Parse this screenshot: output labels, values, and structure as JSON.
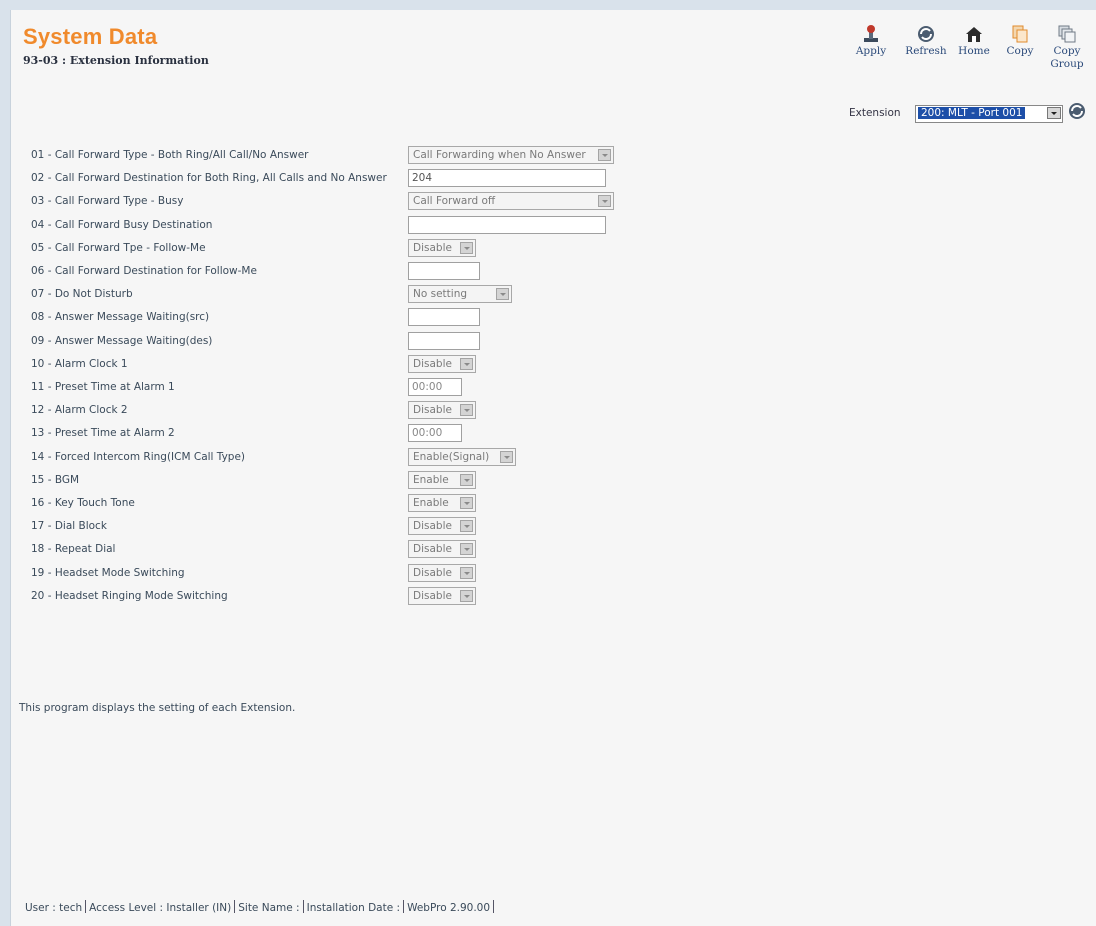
{
  "header": {
    "title": "System Data",
    "subtitle": "93-03 : Extension Information"
  },
  "toolbar": {
    "apply": "Apply",
    "refresh": "Refresh",
    "home": "Home",
    "copy": "Copy",
    "copy_group": "Copy Group"
  },
  "extension": {
    "label": "Extension",
    "selected": "200: MLT - Port 001"
  },
  "rows": [
    {
      "label": "01 - Call Forward Type - Both Ring/All Call/No Answer",
      "type": "select",
      "value": "Call Forwarding when No Answer"
    },
    {
      "label": "02 - Call Forward Destination for Both Ring, All Calls and No Answer",
      "type": "text",
      "value": "204"
    },
    {
      "label": "03 - Call Forward Type - Busy",
      "type": "select",
      "value": "Call Forward off"
    },
    {
      "label": "04 - Call Forward Busy Destination",
      "type": "text",
      "value": ""
    },
    {
      "label": "05 - Call Forward Tpe - Follow-Me",
      "type": "select",
      "value": "Disable"
    },
    {
      "label": "06 - Call Forward Destination for Follow-Me",
      "type": "text",
      "value": ""
    },
    {
      "label": "07 - Do Not Disturb",
      "type": "select",
      "value": "No setting"
    },
    {
      "label": "08 - Answer Message Waiting(src)",
      "type": "text",
      "value": ""
    },
    {
      "label": "09 - Answer Message Waiting(des)",
      "type": "text",
      "value": ""
    },
    {
      "label": "10 - Alarm Clock 1",
      "type": "select",
      "value": "Disable"
    },
    {
      "label": "11 - Preset Time at Alarm 1",
      "type": "text",
      "value": "00:00"
    },
    {
      "label": "12 - Alarm Clock 2",
      "type": "select",
      "value": "Disable"
    },
    {
      "label": "13 - Preset Time at Alarm 2",
      "type": "text",
      "value": "00:00"
    },
    {
      "label": "14 - Forced Intercom Ring(ICM Call Type)",
      "type": "select",
      "value": "Enable(Signal)"
    },
    {
      "label": "15 - BGM",
      "type": "select",
      "value": "Enable"
    },
    {
      "label": "16 - Key Touch Tone",
      "type": "select",
      "value": "Enable"
    },
    {
      "label": "17 - Dial Block",
      "type": "select",
      "value": "Disable"
    },
    {
      "label": "18 - Repeat Dial",
      "type": "select",
      "value": "Disable"
    },
    {
      "label": "19 - Headset Mode Switching",
      "type": "select",
      "value": "Disable"
    },
    {
      "label": "20 - Headset Ringing Mode Switching",
      "type": "select",
      "value": "Disable"
    }
  ],
  "description": "This program displays the setting of each Extension.",
  "footer": {
    "user": "User : tech",
    "access": "Access Level : Installer (IN)",
    "site": "Site Name :",
    "install": "Installation Date :",
    "version": "WebPro 2.90.00"
  }
}
